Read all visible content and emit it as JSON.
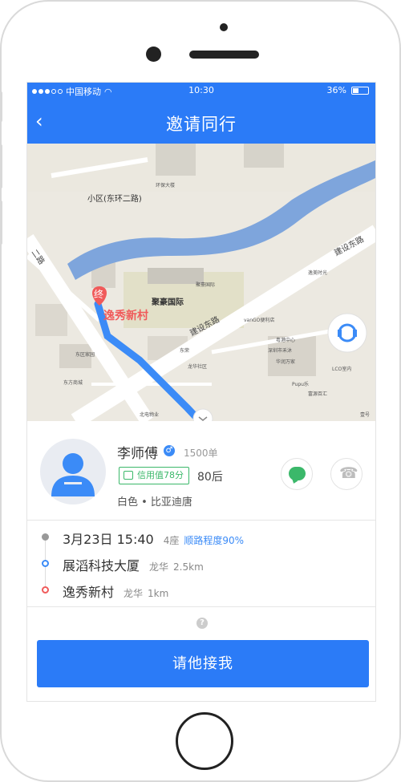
{
  "status_bar": {
    "carrier": "中国移动",
    "time": "10:30",
    "battery": "36%"
  },
  "nav": {
    "title": "邀请同行",
    "back_icon": "chevron-left-icon"
  },
  "map": {
    "area_label": "小区(东环二路)",
    "poi_main": "聚豪国际",
    "road_jianshe_dong": "建设东路",
    "road_jianshe_dong_2": "建设东路",
    "road_dongqer": "二路",
    "end_marker": "终",
    "end_label": "逸秀新村",
    "small_labels": [
      "环保大楼",
      "聚豪国际",
      "逸美时光",
      "vanGO便利店",
      "粤港中心",
      "深圳市禾沐",
      "华润万家",
      "LCO室内",
      "Pupu乐",
      "富源百汇",
      "东方商城",
      "东区家园",
      "东荣",
      "龙华社区",
      "北电物业",
      "壹号"
    ],
    "road_color": "#7ea5dc",
    "route_color": "#3b8bf7",
    "support_icon": "customer-service-icon",
    "collapse_icon": "chevron-down-icon"
  },
  "driver": {
    "name": "李师傅",
    "gender_icon": "male-icon",
    "orders": "1500单",
    "credit": "信用值78分",
    "age_group": "80后",
    "car": "白色 • 比亚迪唐",
    "chat_icon": "chat-icon",
    "phone_icon": "phone-icon",
    "accent_green": "#3bb86a"
  },
  "trip": {
    "date_time": "3月23日 15:40",
    "seats": "4座",
    "match": "顺路程度90%",
    "start_name": "展滔科技大厦",
    "start_district": "龙华",
    "start_distance": "2.5km",
    "end_name": "逸秀新村",
    "end_district": "龙华",
    "end_distance": "1km"
  },
  "help_icon": "question-icon",
  "action": {
    "primary_label": "请他接我",
    "color": "#2b7bf7"
  }
}
